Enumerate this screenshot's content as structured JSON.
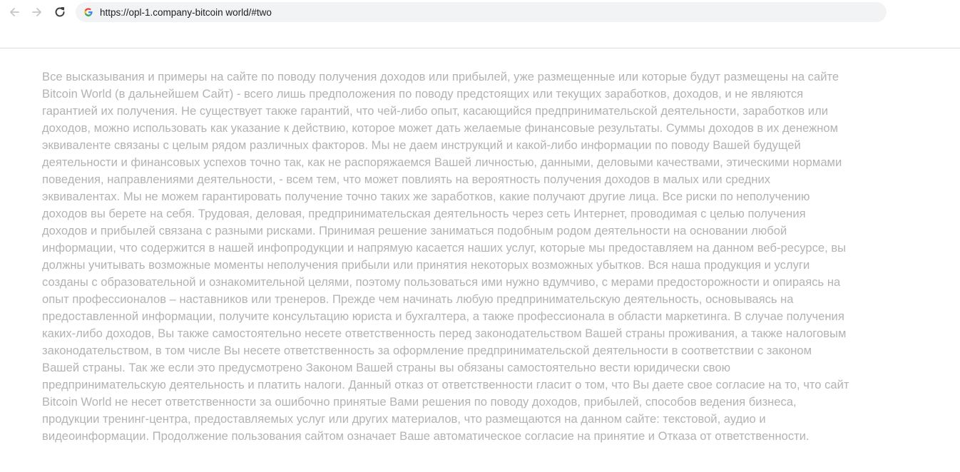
{
  "browser": {
    "url": "https://opl-1.company-bitcoin world/#two",
    "icons": {
      "back": "arrow-left-icon",
      "forward": "arrow-right-icon",
      "reload": "reload-icon",
      "site": "google-g-icon"
    }
  },
  "disclaimer": {
    "lines": [
      "Все высказывания и примеры на сайте по поводу получения доходов или прибылей, уже размещенные или которые будут размещены на сайте",
      "Bitcoin World (в дальнейшем Сайт) - всего лишь предположения по поводу предстоящих или текущих заработков, доходов, и не являются",
      "гарантией их получения. Не существует также гарантий, что чей-либо опыт, касающийся предпринимательской деятельности, заработков или",
      "доходов, можно использовать как указание к действию, которое может дать желаемые финансовые результаты. Суммы доходов в их денежном",
      "эквиваленте связаны с целым рядом различных факторов. Мы не даем инструкций и какой-либо информации по поводу Вашей будущей",
      "деятельности и финансовых успехов точно так, как не распоряжаемся Вашей личностью, данными, деловыми качествами, этическими нормами",
      "поведения, направлениями деятельности, - всем тем, что может повлиять на вероятность получения доходов в малых или средних",
      "эквивалентах. Мы не можем гарантировать получение точно таких же заработков, какие получают другие лица. Все риски по неполучению",
      "доходов вы берете на себя. Трудовая, деловая, предпринимательская деятельность через сеть Интернет, проводимая с целью получения",
      "доходов и прибылей связана с разными рисками. Принимая решение заниматься подобным родом деятельности на основании любой",
      "информации, что содержится в нашей инфопродукции и напрямую касается наших услуг, которые мы предоставляем на данном веб-ресурсе, вы",
      "должны учитывать возможные моменты неполучения прибыли или принятия некоторых возможных убытков. Вся наша продукция и услуги",
      "созданы с образовательной и ознакомительной целями, поэтому пользоваться ими нужно вдумчиво, с мерами предосторожности и опираясь на",
      "опыт профессионалов – наставников или тренеров. Прежде чем начинать любую предпринимательскую деятельность, основываясь на",
      "предоставленной информации, получите консультацию юриста и бухгалтера, а также профессионала в области маркетинга. В случае получения",
      "каких-либо доходов, Вы также самостоятельно несете ответственность перед законодательством Вашей страны проживания, а также налоговым",
      "законодательством, в том числе Вы несете ответственность за оформление предпринимательской деятельности в соответствии с законом",
      "Вашей страны. Так же если это предусмотрено Законом Вашей страны вы обязаны самостоятельно вести юридически свою",
      "предпринимательскую деятельность и платить налоги. Данный отказ от ответственности гласит о том, что Вы даете свое согласие на то, что сайт",
      "Bitcoin World не несет ответственности за ошибочно принятые Вами решения по поводу доходов, прибылей, способов ведения бизнеса,",
      "продукции тренинг-центра, предоставляемых услуг или других материалов, что размещаются на данном сайте: текстовой, аудио и",
      "видеоинформации. Продолжение пользования сайтом означает Ваше автоматическое согласие на принятие и Отказа от ответственности."
    ]
  }
}
